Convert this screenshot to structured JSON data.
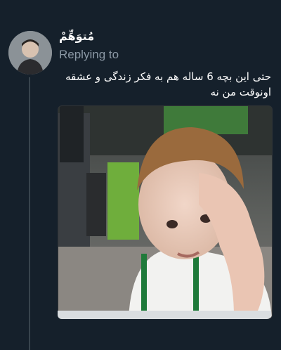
{
  "tweet": {
    "author_name": "مُتوَهِّمْ",
    "replying_label": "Replying to",
    "text": "حتی این بچه 6 ساله هم به فکر زندگی و عشقه اونوقت من نه"
  },
  "media": {
    "icon": "photo-icon"
  }
}
